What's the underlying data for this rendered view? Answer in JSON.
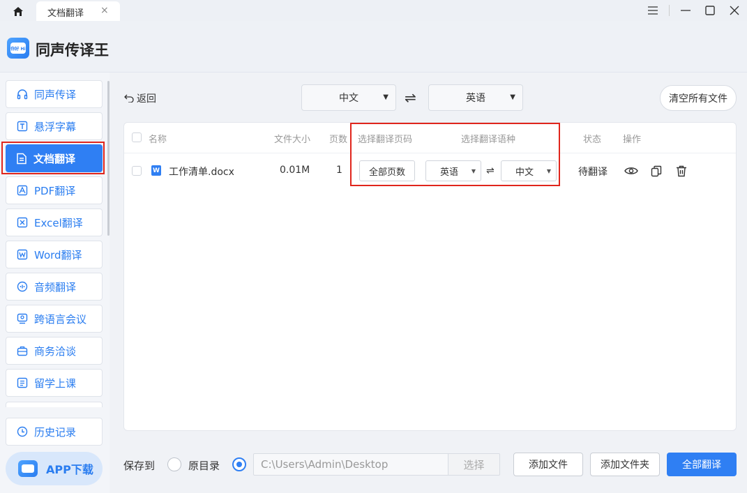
{
  "titlebar": {
    "tab_label": "文档翻译",
    "tab_close": "×",
    "controls": {
      "menu_icon": "menu-icon",
      "minimize_icon": "minimize-icon",
      "maximize_icon": "maximize-icon",
      "close_icon": "close-icon"
    }
  },
  "app": {
    "title": "同声传译王",
    "logo_text": "你好 Hi"
  },
  "sidebar": {
    "items": [
      {
        "label": "同声传译",
        "icon": "headphones-icon"
      },
      {
        "label": "悬浮字幕",
        "icon": "text-box-icon"
      },
      {
        "label": "文档翻译",
        "icon": "document-icon"
      },
      {
        "label": "PDF翻译",
        "icon": "pdf-icon"
      },
      {
        "label": "Excel翻译",
        "icon": "excel-icon"
      },
      {
        "label": "Word翻译",
        "icon": "word-icon"
      },
      {
        "label": "音频翻译",
        "icon": "audio-icon"
      },
      {
        "label": "跨语言会议",
        "icon": "meeting-icon"
      },
      {
        "label": "商务洽谈",
        "icon": "briefcase-icon"
      },
      {
        "label": "留学上课",
        "icon": "book-icon"
      }
    ],
    "history": {
      "label": "历史记录",
      "icon": "clock-icon"
    },
    "app_download": "APP下载",
    "colors": {
      "active_bg": "#2f7ff3",
      "accent": "#2a7df0",
      "highlight_border": "#e0251c"
    }
  },
  "toolbar": {
    "back_label": "返回",
    "source_lang": "中文",
    "target_lang": "英语",
    "swap_symbol": "⇌",
    "clear_label": "清空所有文件"
  },
  "table": {
    "headers": {
      "name": "名称",
      "size": "文件大小",
      "pages": "页数",
      "page_range": "选择翻译页码",
      "language": "选择翻译语种",
      "status": "状态",
      "actions": "操作"
    },
    "rows": [
      {
        "icon_letter": "W",
        "name": "工作清单.docx",
        "size": "0.01M",
        "pages": "1",
        "page_range_btn": "全部页数",
        "from_lang": "英语",
        "to_lang": "中文",
        "swap_symbol": "⇌",
        "status": "待翻译",
        "actions": [
          "eye-icon",
          "copy-icon",
          "trash-icon"
        ]
      }
    ]
  },
  "bottom": {
    "save_to": "保存到",
    "original_dir": "原目录",
    "path_value": "C:\\Users\\Admin\\Desktop",
    "choose_label": "选择",
    "add_file": "添加文件",
    "add_folder": "添加文件夹",
    "translate_all": "全部翻译",
    "selected_option": "custom_path"
  }
}
